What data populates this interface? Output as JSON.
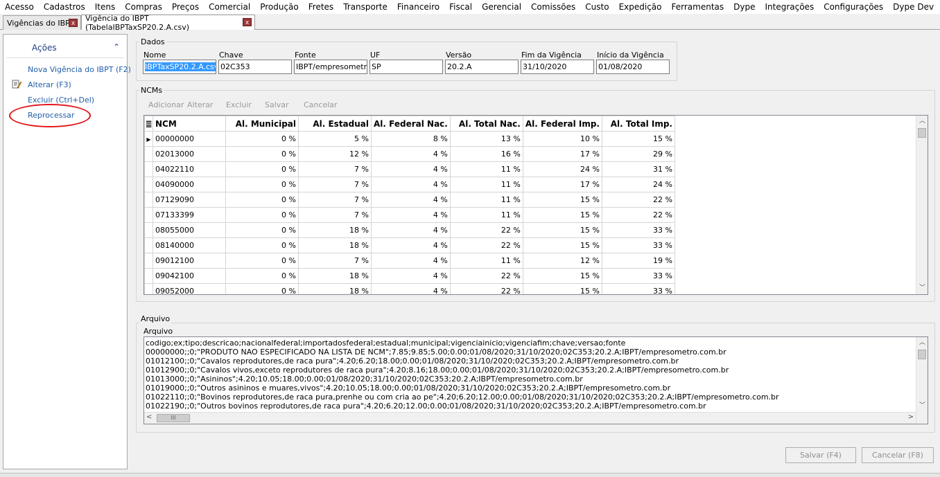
{
  "menu": [
    "Acesso",
    "Cadastros",
    "Itens",
    "Compras",
    "Preços",
    "Comercial",
    "Produção",
    "Fretes",
    "Transporte",
    "Financeiro",
    "Fiscal",
    "Gerencial",
    "Comissões",
    "Custo",
    "Expedição",
    "Ferramentas",
    "Dype",
    "Integrações",
    "Configurações",
    "Dype Dev"
  ],
  "tabs": [
    {
      "label": "Vigências do IBPT",
      "close": "x"
    },
    {
      "label": "Vigência do IBPT (TabelaIBPTaxSP20.2.A.csv)",
      "close": "x"
    }
  ],
  "actions": {
    "title": "Ações",
    "chevron": "⌃",
    "items": [
      {
        "label": "Nova Vigência do IBPT (F2)"
      },
      {
        "label": "Alterar (F3)",
        "icon": "edit-icon"
      },
      {
        "label": "Excluir (Ctrl+Del)"
      },
      {
        "label": "Reprocessar"
      }
    ]
  },
  "dados": {
    "title": "Dados",
    "fields": [
      {
        "label": "Nome",
        "value": "IBPTaxSP20.2.A.csv"
      },
      {
        "label": "Chave",
        "value": "02C353"
      },
      {
        "label": "Fonte",
        "value": "IBPT/empresometro.c"
      },
      {
        "label": "UF",
        "value": "SP"
      },
      {
        "label": "Versão",
        "value": "20.2.A"
      },
      {
        "label": "Fim da Vigência",
        "value": "31/10/2020"
      },
      {
        "label": "Início da Vigência",
        "value": "01/08/2020"
      }
    ]
  },
  "ncms": {
    "title": "NCMs",
    "toolbar": [
      "Adicionar",
      "Alterar",
      "Excluir",
      "Salvar",
      "Cancelar"
    ],
    "columns": [
      "NCM",
      "Al. Municipal",
      "Al. Estadual",
      "Al. Federal Nac.",
      "Al. Total Nac.",
      "Al. Federal Imp.",
      "Al. Total Imp."
    ],
    "rows": [
      [
        "00000000",
        "0 %",
        "5 %",
        "8 %",
        "13 %",
        "10 %",
        "15 %"
      ],
      [
        "02013000",
        "0 %",
        "12 %",
        "4 %",
        "16 %",
        "17 %",
        "29 %"
      ],
      [
        "04022110",
        "0 %",
        "7 %",
        "4 %",
        "11 %",
        "24 %",
        "31 %"
      ],
      [
        "04090000",
        "0 %",
        "7 %",
        "4 %",
        "11 %",
        "17 %",
        "24 %"
      ],
      [
        "07129090",
        "0 %",
        "7 %",
        "4 %",
        "11 %",
        "15 %",
        "22 %"
      ],
      [
        "07133399",
        "0 %",
        "7 %",
        "4 %",
        "11 %",
        "15 %",
        "22 %"
      ],
      [
        "08055000",
        "0 %",
        "18 %",
        "4 %",
        "22 %",
        "15 %",
        "33 %"
      ],
      [
        "08140000",
        "0 %",
        "18 %",
        "4 %",
        "22 %",
        "15 %",
        "33 %"
      ],
      [
        "09012100",
        "0 %",
        "7 %",
        "4 %",
        "11 %",
        "12 %",
        "19 %"
      ],
      [
        "09042100",
        "0 %",
        "18 %",
        "4 %",
        "22 %",
        "15 %",
        "33 %"
      ],
      [
        "09052000",
        "0 %",
        "18 %",
        "4 %",
        "22 %",
        "15 %",
        "33 %"
      ]
    ]
  },
  "arquivo": {
    "group_title": "Arquivo",
    "label": "Arquivo",
    "lines": [
      "codigo;ex;tipo;descricao;nacionalfederal;importadosfederal;estadual;municipal;vigenciainicio;vigenciafim;chave;versao;fonte",
      "00000000;;0;\"PRODUTO NAO ESPECIFICADO NA LISTA DE NCM\";7.85;9.85;5.00;0.00;01/08/2020;31/10/2020;02C353;20.2.A;IBPT/empresometro.com.br",
      "01012100;;0;\"Cavalos reprodutores,de raca pura\";4.20;6.20;18.00;0.00;01/08/2020;31/10/2020;02C353;20.2.A;IBPT/empresometro.com.br",
      "01012900;;0;\"Cavalos vivos,exceto reprodutores de raca pura\";4.20;8.16;18.00;0.00;01/08/2020;31/10/2020;02C353;20.2.A;IBPT/empresometro.com.br",
      "01013000;;0;\"Asininos\";4.20;10.05;18.00;0.00;01/08/2020;31/10/2020;02C353;20.2.A;IBPT/empresometro.com.br",
      "01019000;;0;\"Outros asininos e muares,vivos\";4.20;10.05;18.00;0.00;01/08/2020;31/10/2020;02C353;20.2.A;IBPT/empresometro.com.br",
      "01022110;;0;\"Bovinos reprodutores,de raca pura,prenhe ou com cria ao pe\";4.20;6.20;12.00;0.00;01/08/2020;31/10/2020;02C353;20.2.A;IBPT/empresometro.com.br",
      "01022190;;0;\"Outros bovinos reprodutores,de raca pura\";4.20;6.20;12.00;0.00;01/08/2020;31/10/2020;02C353;20.2.A;IBPT/empresometro.com.br"
    ],
    "scroll_glyph": "III"
  },
  "buttons": {
    "save": "Salvar (F4)",
    "cancel": "Cancelar (F8)"
  },
  "colors": {
    "link": "#1f5eaa",
    "highlight": "#e3141a",
    "selection": "#3399ff"
  }
}
